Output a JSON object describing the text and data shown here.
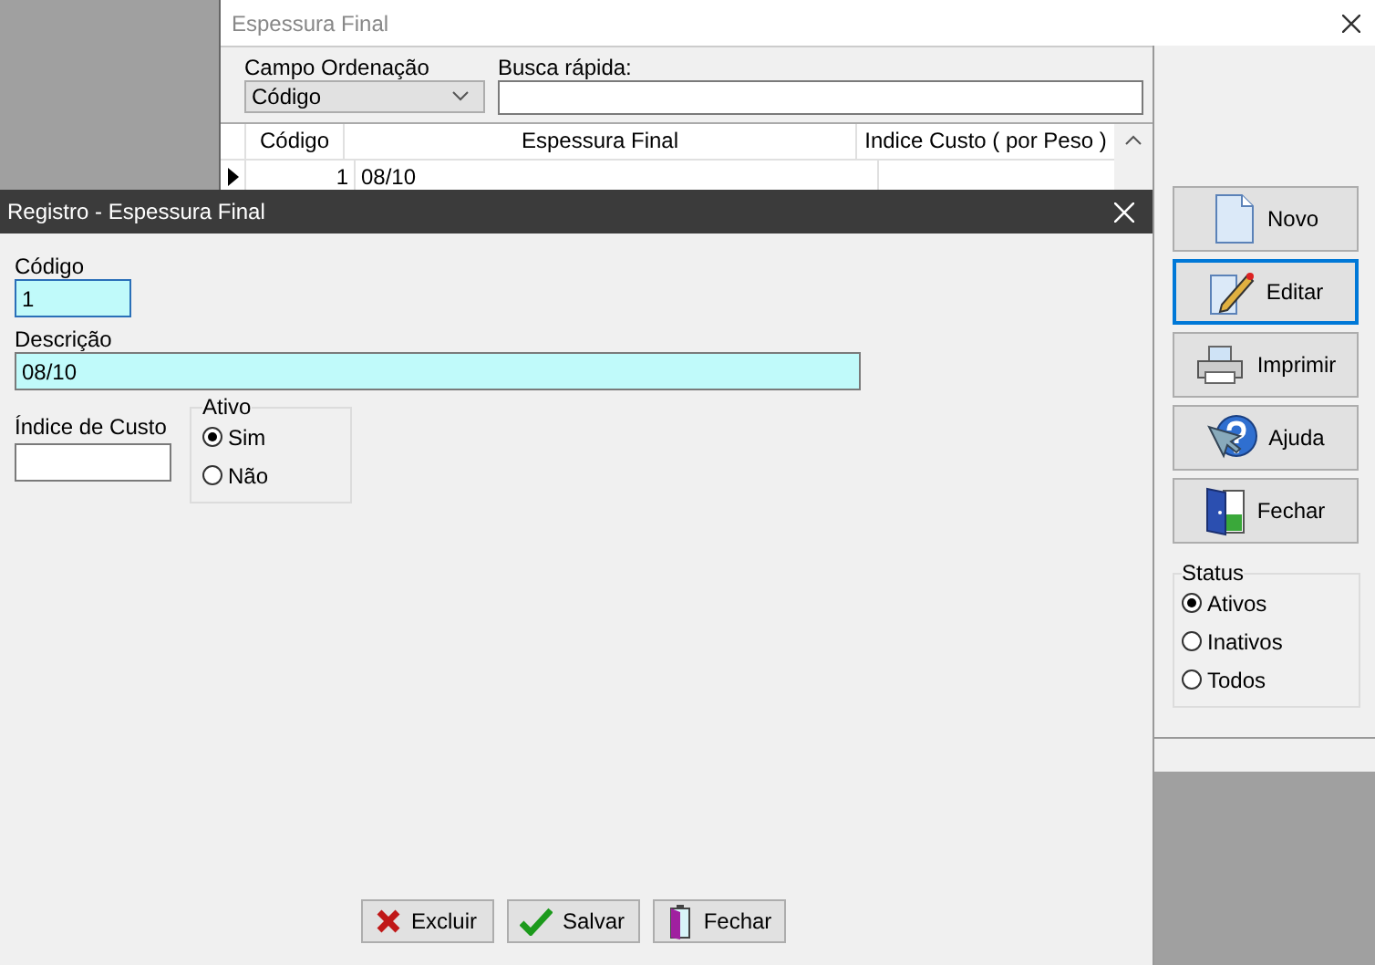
{
  "main_window": {
    "title": "Espessura Final",
    "sort_field": {
      "label": "Campo Ordenação",
      "value": "Código"
    },
    "quick_search": {
      "label": "Busca rápida:"
    },
    "table": {
      "columns": [
        "Código",
        "Espessura Final",
        "Indice Custo ( por Peso )"
      ],
      "rows": [
        {
          "selected": true,
          "cells": [
            "1",
            "08/10"
          ]
        }
      ]
    },
    "buttons": [
      {
        "label": "Novo",
        "kind": "new",
        "focused": false
      },
      {
        "label": "Editar",
        "kind": "edit",
        "focused": true
      },
      {
        "label": "Imprimir",
        "kind": "print",
        "focused": false
      },
      {
        "label": "Ajuda",
        "kind": "help",
        "focused": false
      },
      {
        "label": "Fechar",
        "kind": "exit",
        "focused": false
      }
    ],
    "status": {
      "label": "Status",
      "options": [
        {
          "label": "Ativos",
          "selected": true
        },
        {
          "label": "Inativos",
          "selected": false
        },
        {
          "label": "Todos",
          "selected": false
        }
      ]
    }
  },
  "dialog": {
    "title": "Registro - Espessura Final",
    "fields": [
      {
        "label": "Código",
        "value": "1",
        "kind": "short"
      },
      {
        "label": "Descrição",
        "value": "08/10",
        "kind": "wide"
      }
    ],
    "cost_index": {
      "label": "Índice de Custo"
    },
    "active": {
      "label": "Ativo",
      "options": [
        {
          "label": "Sim",
          "selected": true
        },
        {
          "label": "Não",
          "selected": false
        }
      ]
    },
    "buttons": [
      {
        "label": "Excluir",
        "kind": "delete"
      },
      {
        "label": "Salvar",
        "kind": "save"
      },
      {
        "label": "Fechar",
        "kind": "close"
      }
    ]
  }
}
